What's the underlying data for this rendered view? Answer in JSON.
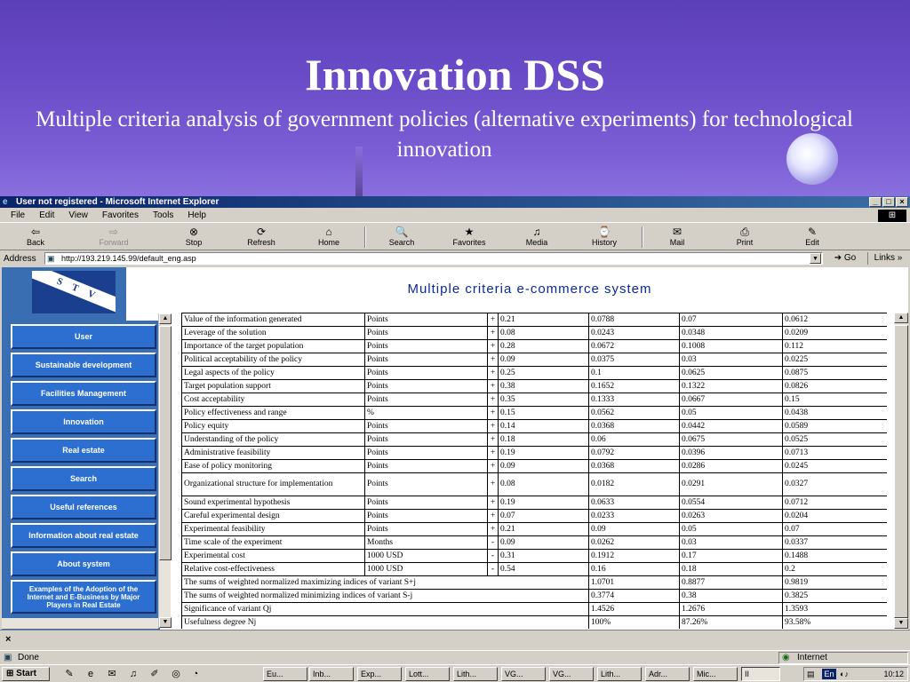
{
  "slide": {
    "title": "Innovation DSS",
    "subtitle": "Multiple criteria analysis of government policies (alternative experiments) for technological innovation"
  },
  "browser": {
    "window_title": "User not registered - Microsoft Internet Explorer",
    "menu": [
      "File",
      "Edit",
      "View",
      "Favorites",
      "Tools",
      "Help"
    ],
    "toolbar": [
      {
        "label": "Back",
        "icon": "back-arrow-icon"
      },
      {
        "label": "Forward",
        "icon": "forward-arrow-icon"
      },
      {
        "label": "Stop",
        "icon": "stop-icon"
      },
      {
        "label": "Refresh",
        "icon": "refresh-icon"
      },
      {
        "label": "Home",
        "icon": "home-icon"
      },
      {
        "label": "Search",
        "icon": "search-icon"
      },
      {
        "label": "Favorites",
        "icon": "favorites-icon"
      },
      {
        "label": "Media",
        "icon": "media-icon"
      },
      {
        "label": "History",
        "icon": "history-icon"
      },
      {
        "label": "Mail",
        "icon": "mail-icon"
      },
      {
        "label": "Print",
        "icon": "print-icon"
      },
      {
        "label": "Edit",
        "icon": "edit-icon"
      }
    ],
    "address_label": "Address",
    "address_url": "http://193.219.145.99/default_eng.asp",
    "go_label": "Go",
    "links_label": "Links",
    "status_text": "Done",
    "status_zone": "Internet"
  },
  "page": {
    "heading": "Multiple criteria e-commerce system",
    "nav": [
      "User",
      "Sustainable development",
      "Facilities Management",
      "Innovation",
      "Real estate",
      "Search",
      "Useful references",
      "Information about real estate",
      "About system",
      "Examples of the Adoption of the Internet and E-Business by Major Players in Real Estate"
    ],
    "table_rows": [
      [
        "Value of the information generated",
        "Points",
        "+",
        "0.21",
        "0.0788",
        "0.07",
        "0.0612"
      ],
      [
        "Leverage of the solution",
        "Points",
        "+",
        "0.08",
        "0.0243",
        "0.0348",
        "0.0209"
      ],
      [
        "Importance of the target population",
        "Points",
        "+",
        "0.28",
        "0.0672",
        "0.1008",
        "0.112"
      ],
      [
        "Political acceptability of the policy",
        "Points",
        "+",
        "0.09",
        "0.0375",
        "0.03",
        "0.0225"
      ],
      [
        "Legal aspects of the policy",
        "Points",
        "+",
        "0.25",
        "0.1",
        "0.0625",
        "0.0875"
      ],
      [
        "Target population support",
        "Points",
        "+",
        "0.38",
        "0.1652",
        "0.1322",
        "0.0826"
      ],
      [
        "Cost acceptability",
        "Points",
        "+",
        "0.35",
        "0.1333",
        "0.0667",
        "0.15"
      ],
      [
        "Policy effectiveness and range",
        "%",
        "+",
        "0.15",
        "0.0562",
        "0.05",
        "0.0438"
      ],
      [
        "Policy equity",
        "Points",
        "+",
        "0.14",
        "0.0368",
        "0.0442",
        "0.0589"
      ],
      [
        "Understanding of the policy",
        "Points",
        "+",
        "0.18",
        "0.06",
        "0.0675",
        "0.0525"
      ],
      [
        "Administrative feasibility",
        "Points",
        "+",
        "0.19",
        "0.0792",
        "0.0396",
        "0.0713"
      ],
      [
        "Ease of policy monitoring",
        "Points",
        "+",
        "0.09",
        "0.0368",
        "0.0286",
        "0.0245"
      ],
      [
        "Organizational structure for implementation",
        "Points",
        "+",
        "0.08",
        "0.0182",
        "0.0291",
        "0.0327"
      ],
      [
        "Sound experimental hypothesis",
        "Points",
        "+",
        "0.19",
        "0.0633",
        "0.0554",
        "0.0712"
      ],
      [
        "Careful experimental design",
        "Points",
        "+",
        "0.07",
        "0.0233",
        "0.0263",
        "0.0204"
      ],
      [
        "Experimental feasibility",
        "Points",
        "+",
        "0.21",
        "0.09",
        "0.05",
        "0.07"
      ],
      [
        "Time scale of the experiment",
        "Months",
        "-",
        "0.09",
        "0.0262",
        "0.03",
        "0.0337"
      ],
      [
        "Experimental cost",
        "1000 USD",
        "-",
        "0.31",
        "0.1912",
        "0.17",
        "0.1488"
      ],
      [
        "Relative cost-effectiveness",
        "1000 USD",
        "-",
        "0.54",
        "0.16",
        "0.18",
        "0.2"
      ]
    ],
    "summary_rows": [
      [
        "The sums of weighted normalized maximizing indices of variant S+j",
        "1.0701",
        "0.8877",
        "0.9819"
      ],
      [
        "The sums of weighted normalized minimizing indices of variant S-j",
        "0.3774",
        "0.38",
        "0.3825"
      ],
      [
        "Significance of variant Qj",
        "1.4526",
        "1.2676",
        "1.3593"
      ],
      [
        "Usefulness degree Nj",
        "100%",
        "87.26%",
        "93.58%"
      ]
    ]
  },
  "taskbar": {
    "start_label": "Start",
    "tasks": [
      "Eu...",
      "Inb...",
      "Exp...",
      "Lott...",
      "Lith...",
      "VG...",
      "VG...",
      "Lith...",
      "Adr...",
      "Mic...",
      "II"
    ],
    "lang": "En",
    "clock": "10:12"
  }
}
